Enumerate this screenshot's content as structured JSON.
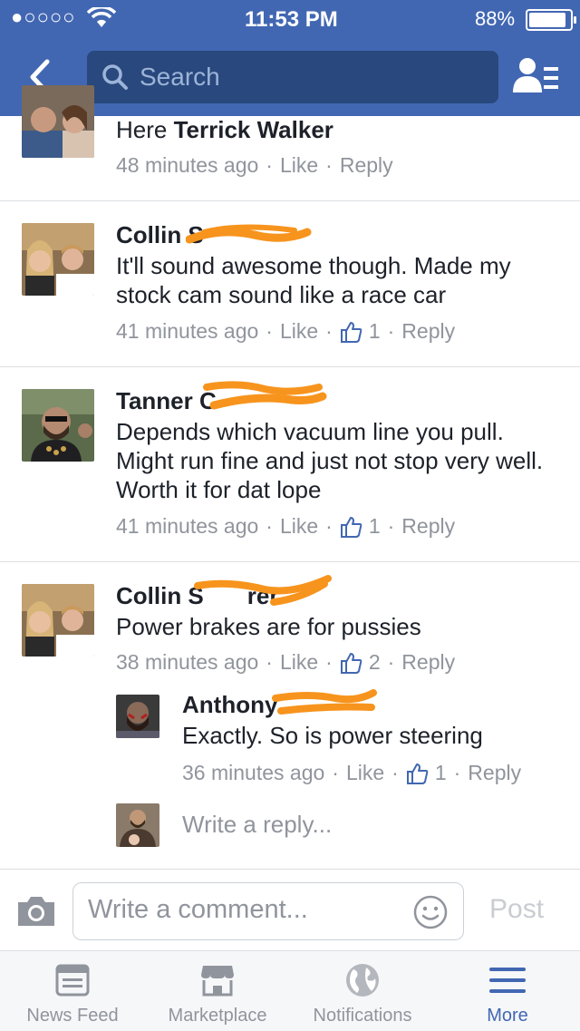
{
  "status_bar": {
    "carrier": "●○○○○",
    "time": "11:53 PM",
    "battery": "88%"
  },
  "header": {
    "back_icon": "chevron-left-icon",
    "search_placeholder": "Search",
    "friends_icon": "friends-list-icon"
  },
  "comments": [
    {
      "author": "Here Terrick Walker",
      "author_prefix": "Here",
      "author_name": "Terrick Walker",
      "time": "48 minutes ago",
      "like": "Like",
      "reply": "Reply"
    },
    {
      "author": "Collin S",
      "text": "It'll sound awesome though. Made my stock cam sound like a race car",
      "time": "41 minutes ago",
      "like": "Like",
      "reactions": "1",
      "reply": "Reply"
    },
    {
      "author": "Tanner C",
      "text": "Depends which vacuum line you pull. Might run fine and just not stop very well. Worth it for dat lope",
      "time": "41 minutes ago",
      "like": "Like",
      "reactions": "1",
      "reply": "Reply"
    },
    {
      "author": "Collin S",
      "author_tail": "rer",
      "text": "Power brakes are for pussies",
      "time": "38 minutes ago",
      "like": "Like",
      "reactions": "2",
      "reply": "Reply"
    }
  ],
  "reply": {
    "author": "Anthony",
    "text": "Exactly. So is power steering",
    "time": "36 minutes ago",
    "like": "Like",
    "reactions": "1",
    "reply": "Reply"
  },
  "write_reply": {
    "placeholder": "Write a reply..."
  },
  "composer": {
    "placeholder": "Write a comment...",
    "post": "Post",
    "camera_icon": "camera-icon",
    "emoji_icon": "smiley-icon"
  },
  "tabs": [
    {
      "label": "News Feed",
      "icon": "news-feed-icon"
    },
    {
      "label": "Marketplace",
      "icon": "marketplace-icon"
    },
    {
      "label": "Notifications",
      "icon": "globe-icon"
    },
    {
      "label": "More",
      "icon": "menu-icon",
      "active": true
    }
  ],
  "colors": {
    "brand": "#4267b2",
    "scribble": "#f7941d",
    "meta": "#90949c"
  }
}
